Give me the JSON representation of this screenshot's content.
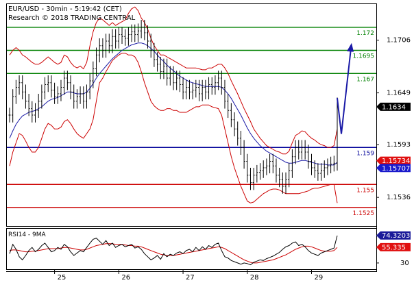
{
  "header": {
    "title": "EUR/USD - 30min - 5:19:42 (CET)",
    "research": "Research © 2018 TRADING CENTRAL"
  },
  "colors": {
    "frame": "#000000",
    "price": "#000000",
    "bollinger": "#cc0000",
    "ma": "#1a1aa6",
    "support_resistance_green": "#008000",
    "pivot_blue": "#000099",
    "support_red": "#cc0000",
    "forecast_arrow": "#1a1aa6",
    "current_badge_bg": "#000000",
    "current_badge_fg": "#ffffff",
    "badge_red_bg": "#e01010",
    "badge_blue_bg": "#1a1acc",
    "rsi_line": "#000000",
    "rsi_ma": "#cc0000",
    "rsi_badge_blue": "#1a1a99",
    "rsi_badge_red": "#e01010"
  },
  "chart_data": {
    "type": "line",
    "main_panel": {
      "ylim": [
        1.1505,
        1.1745
      ],
      "y_ticks": [
        "1.1706",
        "1.1649",
        "1.1593",
        "1.1536"
      ],
      "levels": [
        {
          "value": 1.172,
          "label": "1.172",
          "kind": "resistance"
        },
        {
          "value": 1.1695,
          "label": "1.1695",
          "kind": "resistance"
        },
        {
          "value": 1.167,
          "label": "1.167",
          "kind": "resistance"
        },
        {
          "value": 1.159,
          "label": "1.159",
          "kind": "pivot"
        },
        {
          "value": 1.155,
          "label": "1.155",
          "kind": "support"
        },
        {
          "value": 1.1525,
          "label": "1.1525",
          "kind": "support"
        }
      ],
      "badges": [
        {
          "value": 1.1634,
          "label": "1.1634",
          "kind": "current"
        },
        {
          "value": 1.15734,
          "label": "1.15734",
          "kind": "red"
        },
        {
          "value": 1.15707,
          "label": "1.15707",
          "kind": "blue"
        }
      ],
      "price_close": [
        1.1625,
        1.1645,
        1.1655,
        1.166,
        1.165,
        1.164,
        1.1632,
        1.1625,
        1.163,
        1.164,
        1.165,
        1.1658,
        1.166,
        1.1652,
        1.1645,
        1.1648,
        1.1655,
        1.1665,
        1.166,
        1.165,
        1.164,
        1.1645,
        1.1648,
        1.164,
        1.165,
        1.1662,
        1.1675,
        1.169,
        1.17,
        1.1695,
        1.1705,
        1.17,
        1.171,
        1.1705,
        1.1712,
        1.171,
        1.1708,
        1.1712,
        1.1715,
        1.1712,
        1.1716,
        1.172,
        1.1714,
        1.1705,
        1.1695,
        1.1685,
        1.168,
        1.1672,
        1.1678,
        1.1665,
        1.167,
        1.166,
        1.1665,
        1.1658,
        1.165,
        1.1655,
        1.165,
        1.1652,
        1.1655,
        1.1648,
        1.1655,
        1.165,
        1.1658,
        1.1655,
        1.166,
        1.1665,
        1.1655,
        1.164,
        1.163,
        1.162,
        1.161,
        1.16,
        1.159,
        1.1575,
        1.156,
        1.1552,
        1.156,
        1.1563,
        1.1565,
        1.1568,
        1.157,
        1.1575,
        1.157,
        1.156,
        1.1555,
        1.1548,
        1.1555,
        1.1565,
        1.158,
        1.159,
        1.1585,
        1.159,
        1.1585,
        1.1575,
        1.1568,
        1.1565,
        1.1562,
        1.1565,
        1.1568,
        1.157,
        1.1572,
        1.1573,
        1.1636
      ],
      "bollinger_upper": [
        1.169,
        1.1695,
        1.1698,
        1.1695,
        1.169,
        1.1688,
        1.1685,
        1.1682,
        1.168,
        1.168,
        1.1682,
        1.1685,
        1.1688,
        1.1685,
        1.1682,
        1.168,
        1.1682,
        1.169,
        1.1688,
        1.1682,
        1.1678,
        1.1676,
        1.1678,
        1.1675,
        1.1682,
        1.17,
        1.1715,
        1.1725,
        1.173,
        1.1728,
        1.1725,
        1.1722,
        1.1725,
        1.1722,
        1.1724,
        1.1726,
        1.1728,
        1.1735,
        1.174,
        1.1742,
        1.1738,
        1.173,
        1.1725,
        1.1718,
        1.1708,
        1.17,
        1.1695,
        1.169,
        1.169,
        1.1688,
        1.1686,
        1.1684,
        1.1682,
        1.168,
        1.1678,
        1.1676,
        1.1676,
        1.1676,
        1.1676,
        1.1675,
        1.1674,
        1.1674,
        1.1676,
        1.1676,
        1.1678,
        1.168,
        1.168,
        1.1676,
        1.167,
        1.1662,
        1.1655,
        1.1648,
        1.164,
        1.1632,
        1.1625,
        1.1618,
        1.161,
        1.1605,
        1.16,
        1.1596,
        1.1592,
        1.159,
        1.1588,
        1.1586,
        1.1585,
        1.1583,
        1.1583,
        1.1586,
        1.1595,
        1.1603,
        1.1605,
        1.1608,
        1.1607,
        1.1603,
        1.16,
        1.1598,
        1.1595,
        1.1593,
        1.1592,
        1.159,
        1.159,
        1.1592,
        1.161
      ],
      "bollinger_lower": [
        1.157,
        1.1585,
        1.1595,
        1.1605,
        1.1603,
        1.1597,
        1.159,
        1.1585,
        1.1585,
        1.159,
        1.16,
        1.161,
        1.1616,
        1.1614,
        1.161,
        1.161,
        1.1612,
        1.1618,
        1.162,
        1.1616,
        1.161,
        1.1605,
        1.1602,
        1.16,
        1.1605,
        1.161,
        1.162,
        1.164,
        1.166,
        1.1665,
        1.1672,
        1.1678,
        1.1684,
        1.1687,
        1.169,
        1.1692,
        1.1692,
        1.169,
        1.169,
        1.1688,
        1.1682,
        1.1672,
        1.166,
        1.165,
        1.164,
        1.1635,
        1.1632,
        1.163,
        1.163,
        1.1632,
        1.1632,
        1.163,
        1.163,
        1.1628,
        1.1628,
        1.1628,
        1.163,
        1.1632,
        1.1634,
        1.1634,
        1.1636,
        1.1636,
        1.1636,
        1.1634,
        1.1633,
        1.1632,
        1.1625,
        1.161,
        1.1595,
        1.158,
        1.1568,
        1.1558,
        1.1548,
        1.154,
        1.1532,
        1.153,
        1.1531,
        1.1534,
        1.1537,
        1.154,
        1.1542,
        1.1544,
        1.1545,
        1.1545,
        1.1544,
        1.1542,
        1.154,
        1.154,
        1.154,
        1.154,
        1.154,
        1.1541,
        1.1542,
        1.1543,
        1.1545,
        1.1546,
        1.1546,
        1.1547,
        1.1548,
        1.1549,
        1.155,
        1.155,
        1.153
      ],
      "moving_average": [
        1.16,
        1.1608,
        1.1615,
        1.162,
        1.1624,
        1.1626,
        1.1628,
        1.1629,
        1.163,
        1.1632,
        1.1634,
        1.1637,
        1.164,
        1.1642,
        1.1643,
        1.1644,
        1.1646,
        1.1648,
        1.165,
        1.165,
        1.1649,
        1.1648,
        1.1648,
        1.1648,
        1.165,
        1.1654,
        1.1659,
        1.1665,
        1.167,
        1.1674,
        1.1678,
        1.1682,
        1.1686,
        1.1689,
        1.1692,
        1.1695,
        1.1697,
        1.1699,
        1.1701,
        1.1702,
        1.1703,
        1.1703,
        1.1702,
        1.17,
        1.1697,
        1.1694,
        1.169,
        1.1686,
        1.1683,
        1.1679,
        1.1676,
        1.1673,
        1.167,
        1.1667,
        1.1665,
        1.1663,
        1.1661,
        1.166,
        1.1659,
        1.1658,
        1.1657,
        1.1656,
        1.1656,
        1.1656,
        1.1656,
        1.1656,
        1.1655,
        1.1652,
        1.1648,
        1.1643,
        1.1637,
        1.1631,
        1.1625,
        1.1618,
        1.1611,
        1.1605,
        1.16,
        1.1596,
        1.1592,
        1.1589,
        1.1586,
        1.1584,
        1.1582,
        1.158,
        1.1578,
        1.1576,
        1.1574,
        1.1573,
        1.1573,
        1.1574,
        1.1575,
        1.1576,
        1.1576,
        1.1575,
        1.1574,
        1.1573,
        1.1572,
        1.1572,
        1.1572,
        1.1571,
        1.1571,
        1.1571,
        1.1574
      ],
      "forecast": [
        1.1615,
        1.17
      ]
    },
    "rsi_panel": {
      "label": "RSI14 - 9MA",
      "ylim": [
        20,
        85
      ],
      "y_ticks": [
        "30"
      ],
      "badges": [
        {
          "value": 74.3203,
          "label": "74.3203",
          "kind": "blue"
        },
        {
          "value": 55.335,
          "label": "55.335",
          "kind": "red"
        }
      ],
      "rsi": [
        45,
        60,
        52,
        40,
        35,
        42,
        50,
        55,
        48,
        52,
        58,
        62,
        55,
        48,
        50,
        55,
        52,
        60,
        56,
        48,
        42,
        46,
        50,
        48,
        55,
        62,
        68,
        70,
        65,
        60,
        66,
        58,
        62,
        55,
        58,
        60,
        56,
        58,
        60,
        54,
        56,
        52,
        45,
        40,
        35,
        38,
        42,
        36,
        45,
        40,
        44,
        42,
        46,
        48,
        45,
        50,
        52,
        48,
        55,
        50,
        56,
        52,
        58,
        55,
        60,
        62,
        50,
        40,
        38,
        34,
        32,
        30,
        28,
        30,
        29,
        27,
        31,
        33,
        35,
        34,
        37,
        39,
        41,
        44,
        47,
        52,
        56,
        58,
        62,
        64,
        58,
        60,
        56,
        50,
        46,
        44,
        42,
        46,
        48,
        50,
        52,
        54,
        74
      ],
      "rsi_ma": [
        50,
        51,
        51,
        50,
        49,
        48,
        48,
        49,
        49,
        50,
        51,
        52,
        53,
        53,
        53,
        53,
        54,
        55,
        55,
        54,
        53,
        52,
        51,
        51,
        52,
        54,
        56,
        58,
        59,
        60,
        61,
        61,
        61,
        60,
        60,
        60,
        59,
        58,
        58,
        57,
        57,
        56,
        54,
        52,
        50,
        48,
        46,
        44,
        43,
        42,
        42,
        42,
        43,
        44,
        45,
        46,
        47,
        48,
        49,
        50,
        51,
        52,
        53,
        54,
        55,
        56,
        55,
        53,
        50,
        47,
        44,
        41,
        38,
        35,
        33,
        31,
        30,
        30,
        31,
        32,
        33,
        34,
        35,
        37,
        39,
        41,
        43,
        46,
        49,
        52,
        54,
        56,
        57,
        57,
        56,
        54,
        52,
        50,
        49,
        49,
        49,
        50,
        55
      ]
    },
    "x_axis": {
      "tick_labels": [
        "25",
        "26",
        "27",
        "28",
        "29"
      ],
      "tick_index": [
        14,
        34,
        54,
        74,
        94
      ]
    }
  }
}
